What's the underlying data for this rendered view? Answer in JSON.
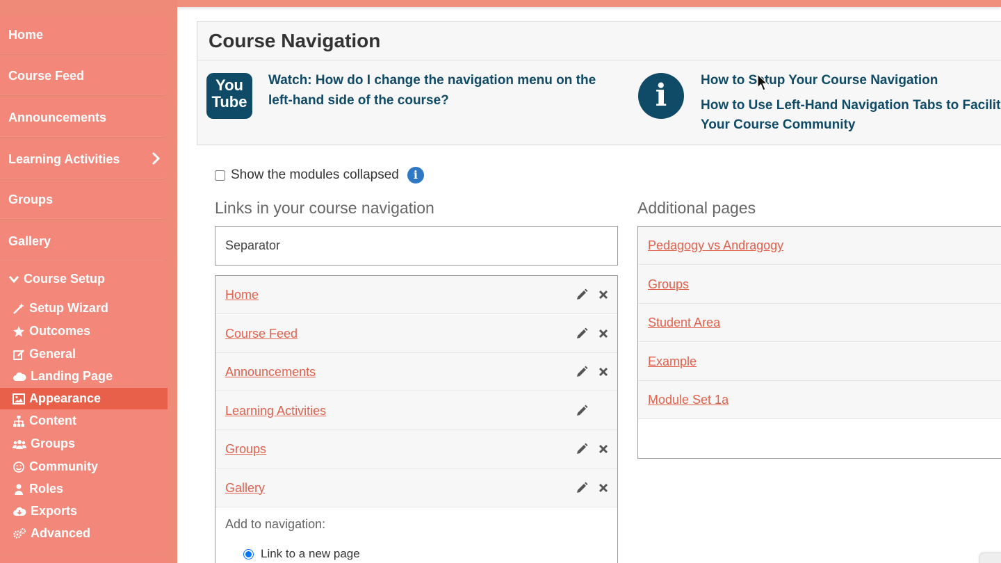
{
  "sidebar": {
    "items": [
      {
        "label": "Home"
      },
      {
        "label": "Course Feed"
      },
      {
        "label": "Announcements"
      },
      {
        "label": "Learning Activities"
      },
      {
        "label": "Groups"
      },
      {
        "label": "Gallery"
      }
    ],
    "setup": {
      "label": "Course Setup",
      "items": [
        {
          "label": "Setup Wizard",
          "icon": "magic-wand-icon"
        },
        {
          "label": "Outcomes",
          "icon": "star-icon"
        },
        {
          "label": "General",
          "icon": "edit-icon"
        },
        {
          "label": "Landing Page",
          "icon": "cloud-icon"
        },
        {
          "label": "Appearance",
          "icon": "image-icon",
          "active": true
        },
        {
          "label": "Content",
          "icon": "sitemap-icon"
        },
        {
          "label": "Groups",
          "icon": "users-icon"
        },
        {
          "label": "Community",
          "icon": "smile-icon"
        },
        {
          "label": "Roles",
          "icon": "user-icon"
        },
        {
          "label": "Exports",
          "icon": "cloud-download-icon"
        },
        {
          "label": "Advanced",
          "icon": "gears-icon"
        }
      ]
    }
  },
  "panel": {
    "title": "Course Navigation",
    "youtube_icon_line1": "You",
    "youtube_icon_line2": "Tube",
    "video_link": "Watch: How do I change the navigation menu on the left-hand side of the course?",
    "help_links": [
      "How to Setup Your Course Navigation",
      "How to Use Left-Hand Navigation Tabs to Facilit",
      "Your Course Community"
    ]
  },
  "options": {
    "collapse_label": "Show the modules collapsed",
    "collapse_checked": false
  },
  "links_section": {
    "title": "Links in your course navigation",
    "separator": "Separator",
    "rows": [
      {
        "label": "Home",
        "deletable": true
      },
      {
        "label": "Course Feed",
        "deletable": true
      },
      {
        "label": "Announcements",
        "deletable": true
      },
      {
        "label": "Learning Activities",
        "deletable": false
      },
      {
        "label": "Groups",
        "deletable": true
      },
      {
        "label": "Gallery",
        "deletable": true
      }
    ],
    "add_label": "Add to navigation:",
    "radio_label": "Link to a new page"
  },
  "pages_section": {
    "title": "Additional pages",
    "rows": [
      {
        "label": "Pedagogy vs Andragogy"
      },
      {
        "label": "Groups"
      },
      {
        "label": "Student Area"
      },
      {
        "label": "Example"
      },
      {
        "label": "Module Set 1a"
      }
    ]
  },
  "colors": {
    "sidebar": "#f08a78",
    "active": "#e8604a",
    "link": "#e2614d",
    "heading": "#0f4a66"
  }
}
